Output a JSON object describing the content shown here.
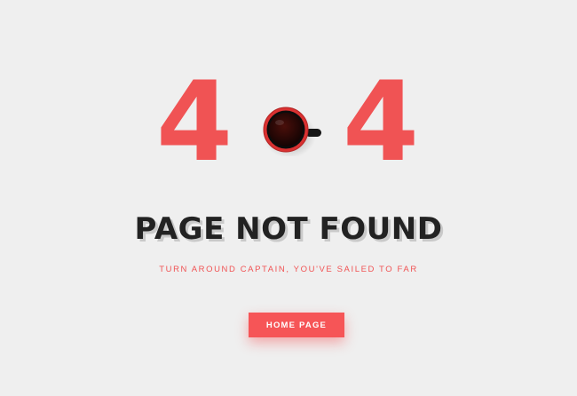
{
  "error": {
    "digit_left": "4",
    "digit_right": "4",
    "middle_icon": "coffee-cup-icon"
  },
  "title": "PAGE NOT FOUND",
  "subtitle": "TURN AROUND CAPTAIN, YOU'VE SAILED TO FAR",
  "home_button": {
    "label": "HOME PAGE"
  },
  "colors": {
    "accent": "#f05354",
    "background": "#efefef",
    "title": "#222222"
  }
}
